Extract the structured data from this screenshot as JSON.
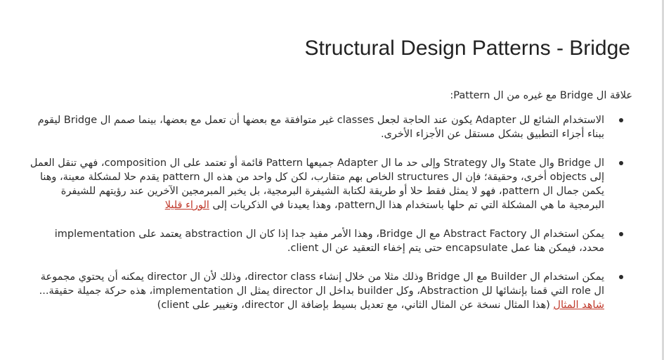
{
  "title": "Structural Design Patterns - Bridge",
  "intro": "علاقة ال Bridge مع غيره من ال Pattern:",
  "bullets": [
    {
      "text": "الاستخدام الشائع لل Adapter يكون عند الحاجة لجعل classes غير متوافقة مع بعضها أن تعمل مع بعضها، بينما صمم ال Bridge ليقوم ببناء أجزاء التطبيق بشكل مستقل عن الأجزاء الأخرى."
    },
    {
      "text": "ال Bridge وال State وال Strategy وإلى حد ما ال Adapter جميعها Pattern قائمة أو تعتمد على ال composition، فهي تنقل العمل إلى objects أخرى، وحقيقة؛ فإن ال structures الخاص بهم متقارب، لكن كل واحد من هذه ال pattern يقدم حلا لمشكلة معينة، وهنا يكمن جمال ال pattern، فهو لا يمثل فقط حلا أو طريقة لكتابة الشيفرة البرمجية، بل يخبر المبرمجين الآخرين عند رؤيتهم للشيفرة البرمجية ما هي المشكلة التي تم حلها باستخدام هذا الpattern، وهذا يعيدنا في الذكريات إلى",
      "link": "الوراء قليلا"
    },
    {
      "text": "يمكن استخدام ال Abstract Factory مع ال Bridge، وهذا الأمر مفيد جدا إذا كان ال abstraction يعتمد على implementation محدد، فيمكن هنا عمل encapsulate حتى يتم إخفاء التعقيد عن ال client."
    },
    {
      "text": "يمكن استخدام ال Builder مع ال Bridge وذلك مثلا من خلال إنشاء director class، وذلك لأن ال director يمكنه أن يحتوي مجموعة ال role التي قمنا بإنشائها لل Abstraction، وكل builder بداخل ال director يمثل ال implementation، هذه حركة جميلة حقيقة...",
      "link": "شاهد المثال",
      "after": " (هذا المثال نسخة عن المثال الثاني، مع تعديل بسيط بإضافة ال director، وتغيير على client)"
    }
  ]
}
